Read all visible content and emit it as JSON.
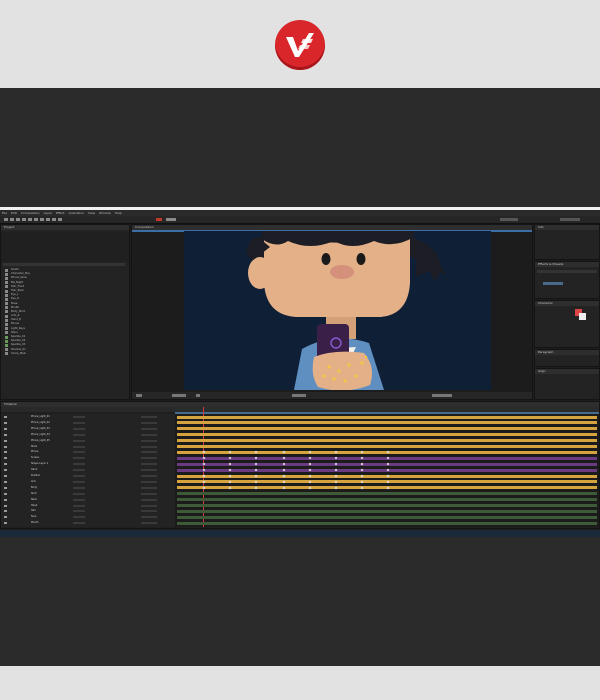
{
  "brand": {
    "logo_icon": "brand-logo-icon",
    "logo_color": "#d8262b"
  },
  "app": {
    "menu": [
      "File",
      "Edit",
      "Composition",
      "Layer",
      "Effect",
      "Animation",
      "View",
      "Window",
      "Help"
    ],
    "panels": {
      "project": "Project",
      "composition": "Composition",
      "timeline": "Timeline",
      "effects": "Effects & Presets",
      "info": "Info",
      "character": "Character",
      "paragraph": "Paragraph",
      "align": "Align"
    },
    "project_items": [
      "Solids",
      "Character_Boy",
      "Phone_Glow",
      "BG_Night",
      "Hair_Front",
      "Hair_Back",
      "Eye_L",
      "Eye_R",
      "Nose",
      "Mouth",
      "Body_Shirt",
      "Arm_R",
      "Hand_R",
      "Phone",
      "Light_Rays",
      "Stars",
      "Sparkle_01",
      "Sparkle_02",
      "Sparkle_03",
      "Shadow_01",
      "Comp_Main"
    ],
    "timeline_layers": [
      "Phone_Light_01",
      "Phone_Light_02",
      "Phone_Light_03",
      "Phone_Light_04",
      "Phone_Light_05",
      "Stars",
      "Phone",
      "Screen",
      "Shape Layer 1",
      "Hand",
      "Position",
      "Arm",
      "Body",
      "Shirt",
      "Neck",
      "Head",
      "Hair",
      "Face",
      "Mouth"
    ],
    "colors": {
      "orange_bar": "#d6a43f",
      "purple_bar": "#6a3b80",
      "green_bar": "#3e5a38",
      "viewer_bg": "#0f1f35"
    }
  }
}
